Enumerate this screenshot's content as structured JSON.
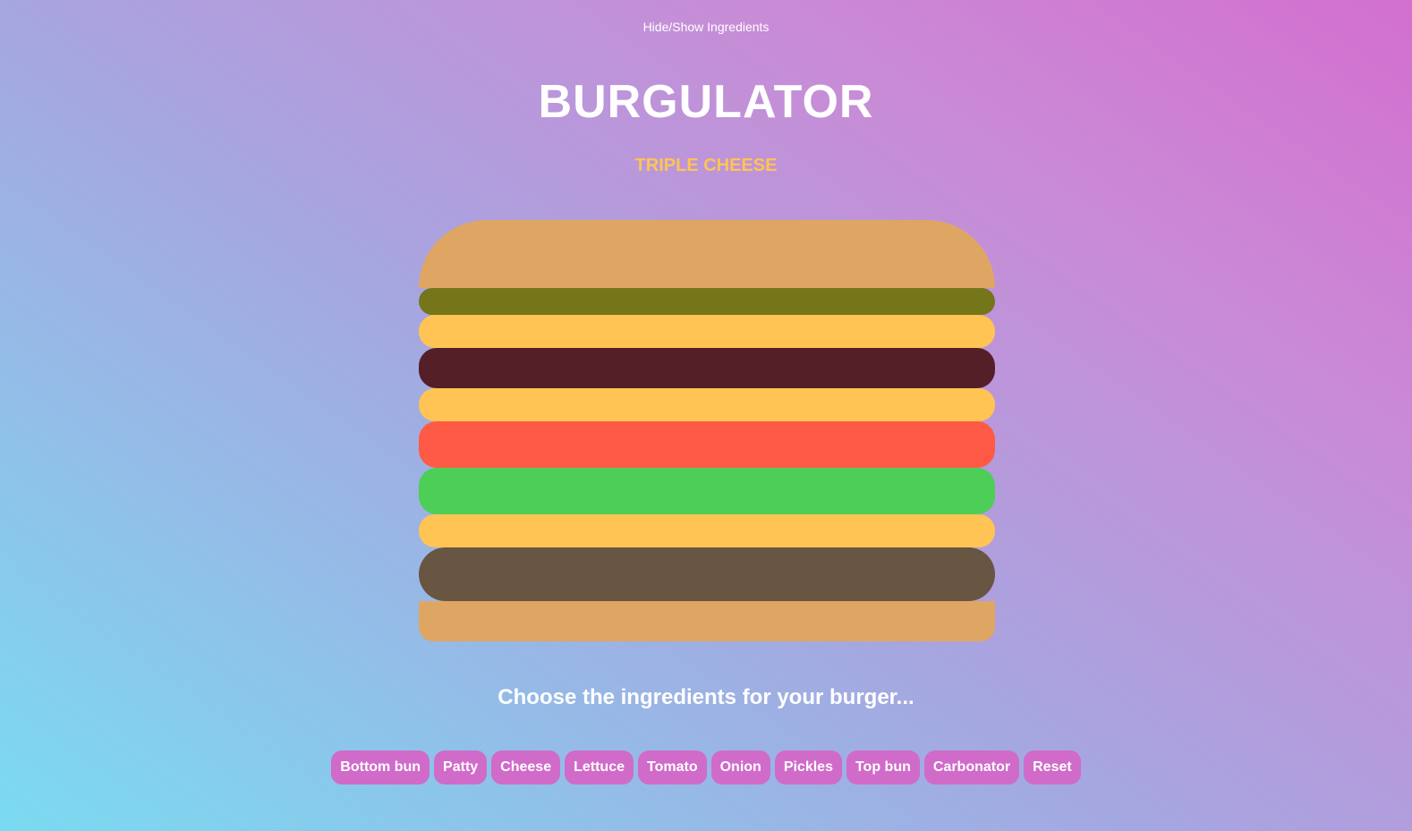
{
  "header": {
    "toggle_label": "Hide/Show Ingredients",
    "title": "BURGULATOR",
    "burger_name": "TRIPLE CHEESE"
  },
  "burger": {
    "layers": [
      "Top bun",
      "Pickles",
      "Cheese",
      "Onion",
      "Cheese",
      "Tomato",
      "Lettuce",
      "Cheese",
      "Patty",
      "Bottom bun"
    ]
  },
  "colors": {
    "bun": "#dfa663",
    "pickles": "#747619",
    "cheese": "#ffc453",
    "onion": "#541f26",
    "tomato": "#ff5a45",
    "lettuce": "#4dce56",
    "patty": "#685542",
    "button": "#d06bc9",
    "subtitle": "#ffc453"
  },
  "controls": {
    "prompt": "Choose the ingredients for your burger...",
    "buttons": [
      "Bottom bun",
      "Patty",
      "Cheese",
      "Lettuce",
      "Tomato",
      "Onion",
      "Pickles",
      "Top bun",
      "Carbonator",
      "Reset"
    ]
  }
}
